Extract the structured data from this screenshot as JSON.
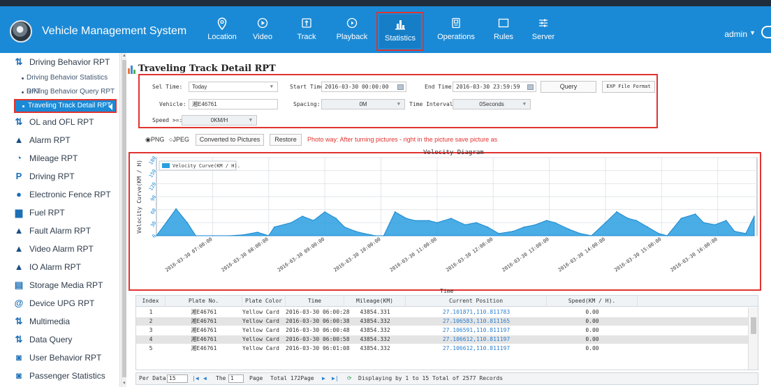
{
  "app": {
    "title": "Vehicle Management System",
    "user": "admin"
  },
  "nav": [
    {
      "label": "Location",
      "icon": "location-pin-icon"
    },
    {
      "label": "Video",
      "icon": "play-circle-icon"
    },
    {
      "label": "Track",
      "icon": "track-icon"
    },
    {
      "label": "Playback",
      "icon": "playback-icon"
    },
    {
      "label": "Statistics",
      "icon": "bar-chart-icon",
      "active": true
    },
    {
      "label": "Operations",
      "icon": "operations-icon"
    },
    {
      "label": "Rules",
      "icon": "rules-icon"
    },
    {
      "label": "Server",
      "icon": "server-sliders-icon"
    }
  ],
  "sidebar": {
    "items": [
      {
        "label": "Driving Behavior RPT",
        "icon": "sort-arrows-icon",
        "glyph": "⇅"
      },
      {
        "label": "OL and OFL RPT",
        "icon": "sort-arrows-icon",
        "glyph": "⇅"
      },
      {
        "label": "Alarm RPT",
        "icon": "warning-triangle-icon",
        "glyph": "▲"
      },
      {
        "label": "Mileage RPT",
        "icon": "gauge-icon",
        "glyph": "◔"
      },
      {
        "label": "Driving RPT",
        "icon": "parking-icon",
        "glyph": "P"
      },
      {
        "label": "Electronic Fence RPT",
        "icon": "map-pin-icon",
        "glyph": "●"
      },
      {
        "label": "Fuel RPT",
        "icon": "fuel-icon",
        "glyph": "▆"
      },
      {
        "label": "Fault Alarm RPT",
        "icon": "warning-triangle-icon",
        "glyph": "▲"
      },
      {
        "label": "Video Alarm RPT",
        "icon": "warning-triangle-icon",
        "glyph": "▲"
      },
      {
        "label": "IO Alarm RPT",
        "icon": "warning-triangle-icon",
        "glyph": "▲"
      },
      {
        "label": "Storage Media RPT",
        "icon": "storage-icon",
        "glyph": "▤"
      },
      {
        "label": "Device UPG RPT",
        "icon": "upgrade-icon",
        "glyph": "@"
      },
      {
        "label": "Multimedia",
        "icon": "sort-arrows-icon",
        "glyph": "⇅"
      },
      {
        "label": "Data Query",
        "icon": "sort-arrows-icon",
        "glyph": "⇅"
      },
      {
        "label": "User Behavior RPT",
        "icon": "search-doc-icon",
        "glyph": "◙"
      },
      {
        "label": "Passenger Statistics RPT",
        "icon": "search-doc-icon",
        "glyph": "◙"
      }
    ],
    "subitems": [
      "Driving Behavior Statistics RPT",
      "Driving Behavior Query RPT",
      "Traveling Track Detail RPT"
    ]
  },
  "page": {
    "title": "Traveling Track Detail RPT"
  },
  "form": {
    "sel_time_label": "Sel Time:",
    "sel_time_value": "Today",
    "start_label": "Start Time:",
    "start_value": "2016-03-30 00:00:00",
    "end_label": "End Time:",
    "end_value": "2016-03-30 23:59:59",
    "query_button": "Query",
    "exp_button": "EXP File Format",
    "vehicle_label": "Vehicle:",
    "vehicle_value": "湘E46761",
    "spacing_label": "Spacing:",
    "spacing_value": "0M",
    "interval_label": "Time Interval:",
    "interval_value": "0Seconds",
    "speed_label": "Speed >=:",
    "speed_value": "0KM/H"
  },
  "export": {
    "png_label": "PNG",
    "jpeg_label": "JPEG",
    "selected": "PNG",
    "convert_button": "Converted to Pictures",
    "restore_button": "Restore",
    "hint": "Photo way: After turning pictures - right in the picture save picture as"
  },
  "chart_data": {
    "type": "area",
    "title": "Velocity Diagram",
    "xlabel": "Time",
    "ylabel": "Velocity Curve(KM / H)",
    "legend": "Velocity Curve(KM / H).",
    "legend_position": "top-left",
    "ylim": [
      0,
      180
    ],
    "yticks": [
      "0",
      "30",
      "60",
      "90",
      "120",
      "150",
      "180"
    ],
    "xticks": [
      "2016-03-30 07:00:00",
      "2016-03-30 08:00:00",
      "2016-03-30 09:00:00",
      "2016-03-30 10:00:00",
      "2016-03-30 11:00:00",
      "2016-03-30 12:00:00",
      "2016-03-30 13:00:00",
      "2016-03-30 14:00:00",
      "2016-03-30 15:00:00",
      "2016-03-30 16:00:00"
    ],
    "grid": true,
    "color": "#2a9fe0",
    "series": [
      {
        "x": [
          6.0,
          6.2,
          6.35,
          6.55,
          6.7,
          7.0,
          7.3,
          7.55,
          7.8,
          8.0,
          8.1,
          8.4,
          8.6,
          8.8,
          9.0,
          9.2,
          9.35,
          9.55,
          9.7,
          9.9,
          10.05,
          10.25,
          10.45,
          10.6,
          10.85,
          11.0,
          11.25,
          11.5,
          11.7,
          11.9,
          12.1,
          12.35,
          12.55,
          12.75,
          12.95,
          13.1,
          13.35,
          13.55,
          13.75,
          14.0,
          14.2,
          14.4,
          14.55,
          14.75,
          14.95,
          15.1,
          15.35,
          15.6,
          15.75,
          15.95,
          16.15,
          16.3,
          16.5,
          16.65
        ],
        "y": [
          0,
          35,
          62,
          30,
          0,
          0,
          0,
          2,
          8,
          0,
          20,
          30,
          45,
          35,
          55,
          40,
          20,
          10,
          5,
          0,
          0,
          55,
          40,
          35,
          35,
          30,
          40,
          25,
          30,
          20,
          5,
          10,
          20,
          25,
          35,
          30,
          15,
          5,
          0,
          30,
          55,
          40,
          35,
          20,
          5,
          0,
          40,
          50,
          30,
          25,
          35,
          10,
          5,
          45
        ]
      }
    ]
  },
  "table": {
    "columns": [
      "Index",
      "Plate No.",
      "Plate Color",
      "Time",
      "Mileage(KM)",
      "Current Position",
      "Speed(KM / H)."
    ],
    "rows": [
      [
        "1",
        "湘E46761",
        "Yellow Card",
        "2016-03-30 06:00:28",
        "43854.331",
        "27.101871,110.811783",
        "0.00"
      ],
      [
        "2",
        "湘E46761",
        "Yellow Card",
        "2016-03-30 06:00:38",
        "43854.332",
        "27.106583,110.811165",
        "0.00"
      ],
      [
        "3",
        "湘E46761",
        "Yellow Card",
        "2016-03-30 06:00:48",
        "43854.332",
        "27.106591,110.811197",
        "0.00"
      ],
      [
        "4",
        "湘E46761",
        "Yellow Card",
        "2016-03-30 06:00:58",
        "43854.332",
        "27.106612,110.811197",
        "0.00"
      ],
      [
        "5",
        "湘E46761",
        "Yellow Card",
        "2016-03-30 06:01:08",
        "43854.332",
        "27.106612,110.811197",
        "0.00"
      ]
    ]
  },
  "pager": {
    "per_data_label": "Per Data",
    "per_data_value": "15",
    "the_label": "The",
    "page_value": "1",
    "page_label": "Page",
    "total_pages": "Total 172Page",
    "displaying": "Displaying by 1 to 15 Total of 2577 Records"
  }
}
